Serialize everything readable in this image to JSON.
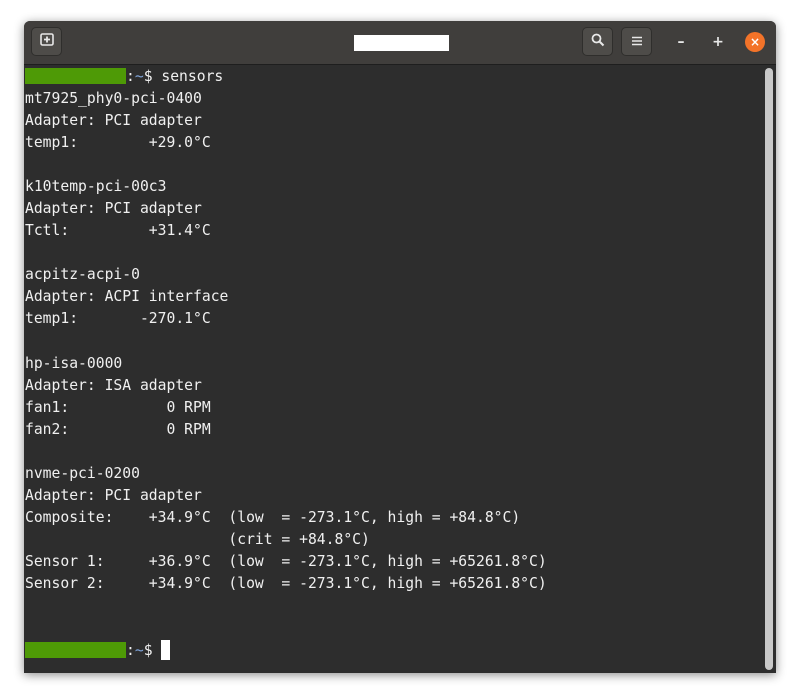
{
  "window": {
    "title": "",
    "controls": {
      "minimize": "–",
      "maximize": "+",
      "close": "×"
    }
  },
  "terminal": {
    "prompt_symbol": ":",
    "prompt_dir": "~",
    "prompt_dollar": "$",
    "command": "sensors",
    "output": [
      "mt7925_phy0-pci-0400",
      "Adapter: PCI adapter",
      "temp1:        +29.0°C",
      "",
      "k10temp-pci-00c3",
      "Adapter: PCI adapter",
      "Tctl:         +31.4°C",
      "",
      "acpitz-acpi-0",
      "Adapter: ACPI interface",
      "temp1:       -270.1°C",
      "",
      "hp-isa-0000",
      "Adapter: ISA adapter",
      "fan1:           0 RPM",
      "fan2:           0 RPM",
      "",
      "nvme-pci-0200",
      "Adapter: PCI adapter",
      "Composite:    +34.9°C  (low  = -273.1°C, high = +84.8°C)",
      "                       (crit = +84.8°C)",
      "Sensor 1:     +36.9°C  (low  = -273.1°C, high = +65261.8°C)",
      "Sensor 2:     +34.9°C  (low  = -273.1°C, high = +65261.8°C)",
      ""
    ]
  },
  "colors": {
    "titlebar": "#403e3c",
    "terminal_bg": "#2d2d2d",
    "terminal_fg": "#f0f0f0",
    "prompt_userhost": "#4e9a06",
    "prompt_dir": "#7ea2d8",
    "close_button": "#f37329"
  },
  "icons": {
    "new_tab": "new-tab-icon",
    "search": "search-icon",
    "menu": "hamburger-menu-icon"
  }
}
